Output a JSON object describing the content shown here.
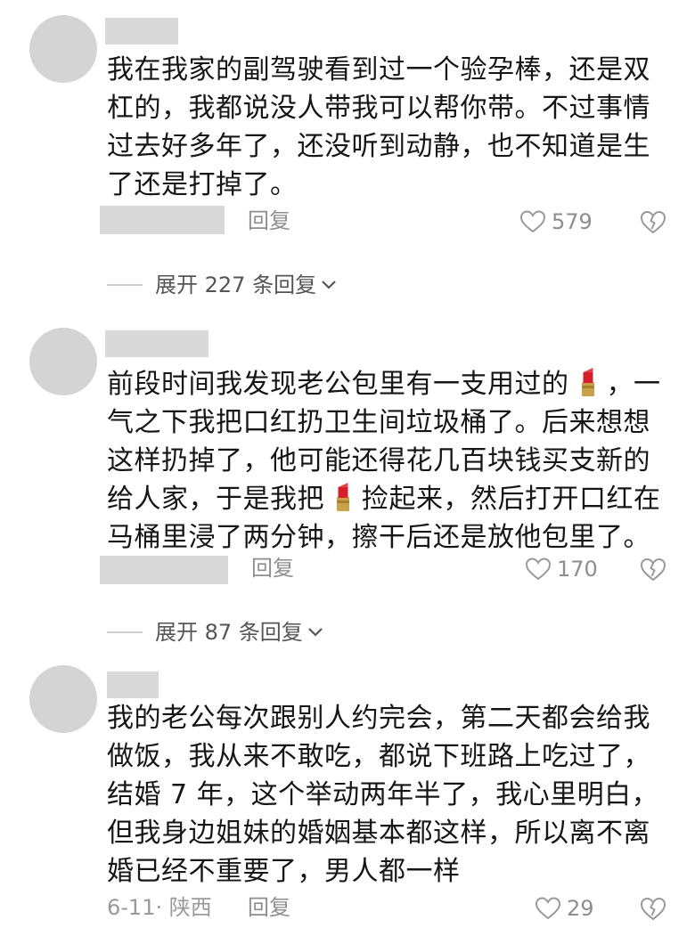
{
  "comments": [
    {
      "text": "我在我家的副驾驶看到过一个验孕棒，还是双杠的，我都说没人带我可以帮你带。不过事情过去好多年了，还没听到动静，也不知道是生了还是打掉了。",
      "reply_label": "回复",
      "likes": "579",
      "expand_label": "展开 227 条回复"
    },
    {
      "text_parts": [
        "前段时间我发现老公包里有一支用过的",
        "，一气之下我把口红扔卫生间垃圾桶了。后来想想这样扔掉了，他可能还得花几百块钱买支新的给人家，于是我把",
        "捡起来，然后打开口红在马桶里浸了两分钟，擦干后还是放他包里了。"
      ],
      "reply_label": "回复",
      "likes": "170",
      "expand_label": "展开 87 条回复"
    },
    {
      "text": "我的老公每次跟别人约完会，第二天都会给我做饭，我从来不敢吃，都说下班路上吃过了，结婚 7 年，这个举动两年半了，我心里明白，但我身边姐妹的婚姻基本都这样，所以离不离婚已经不重要了，男人都一样",
      "date_location": "6-11· 陕西",
      "reply_label": "回复",
      "likes": "29"
    }
  ],
  "icons": {
    "like": "heart-outline-icon",
    "dislike": "broken-heart-icon",
    "expand": "chevron-down-icon",
    "emoji": "lipstick-emoji"
  },
  "colors": {
    "avatar": "#d4d4d4",
    "redaction": "#d9d9d9",
    "meta_text": "#8e8e8e",
    "lipstick": "#d61f2c"
  }
}
